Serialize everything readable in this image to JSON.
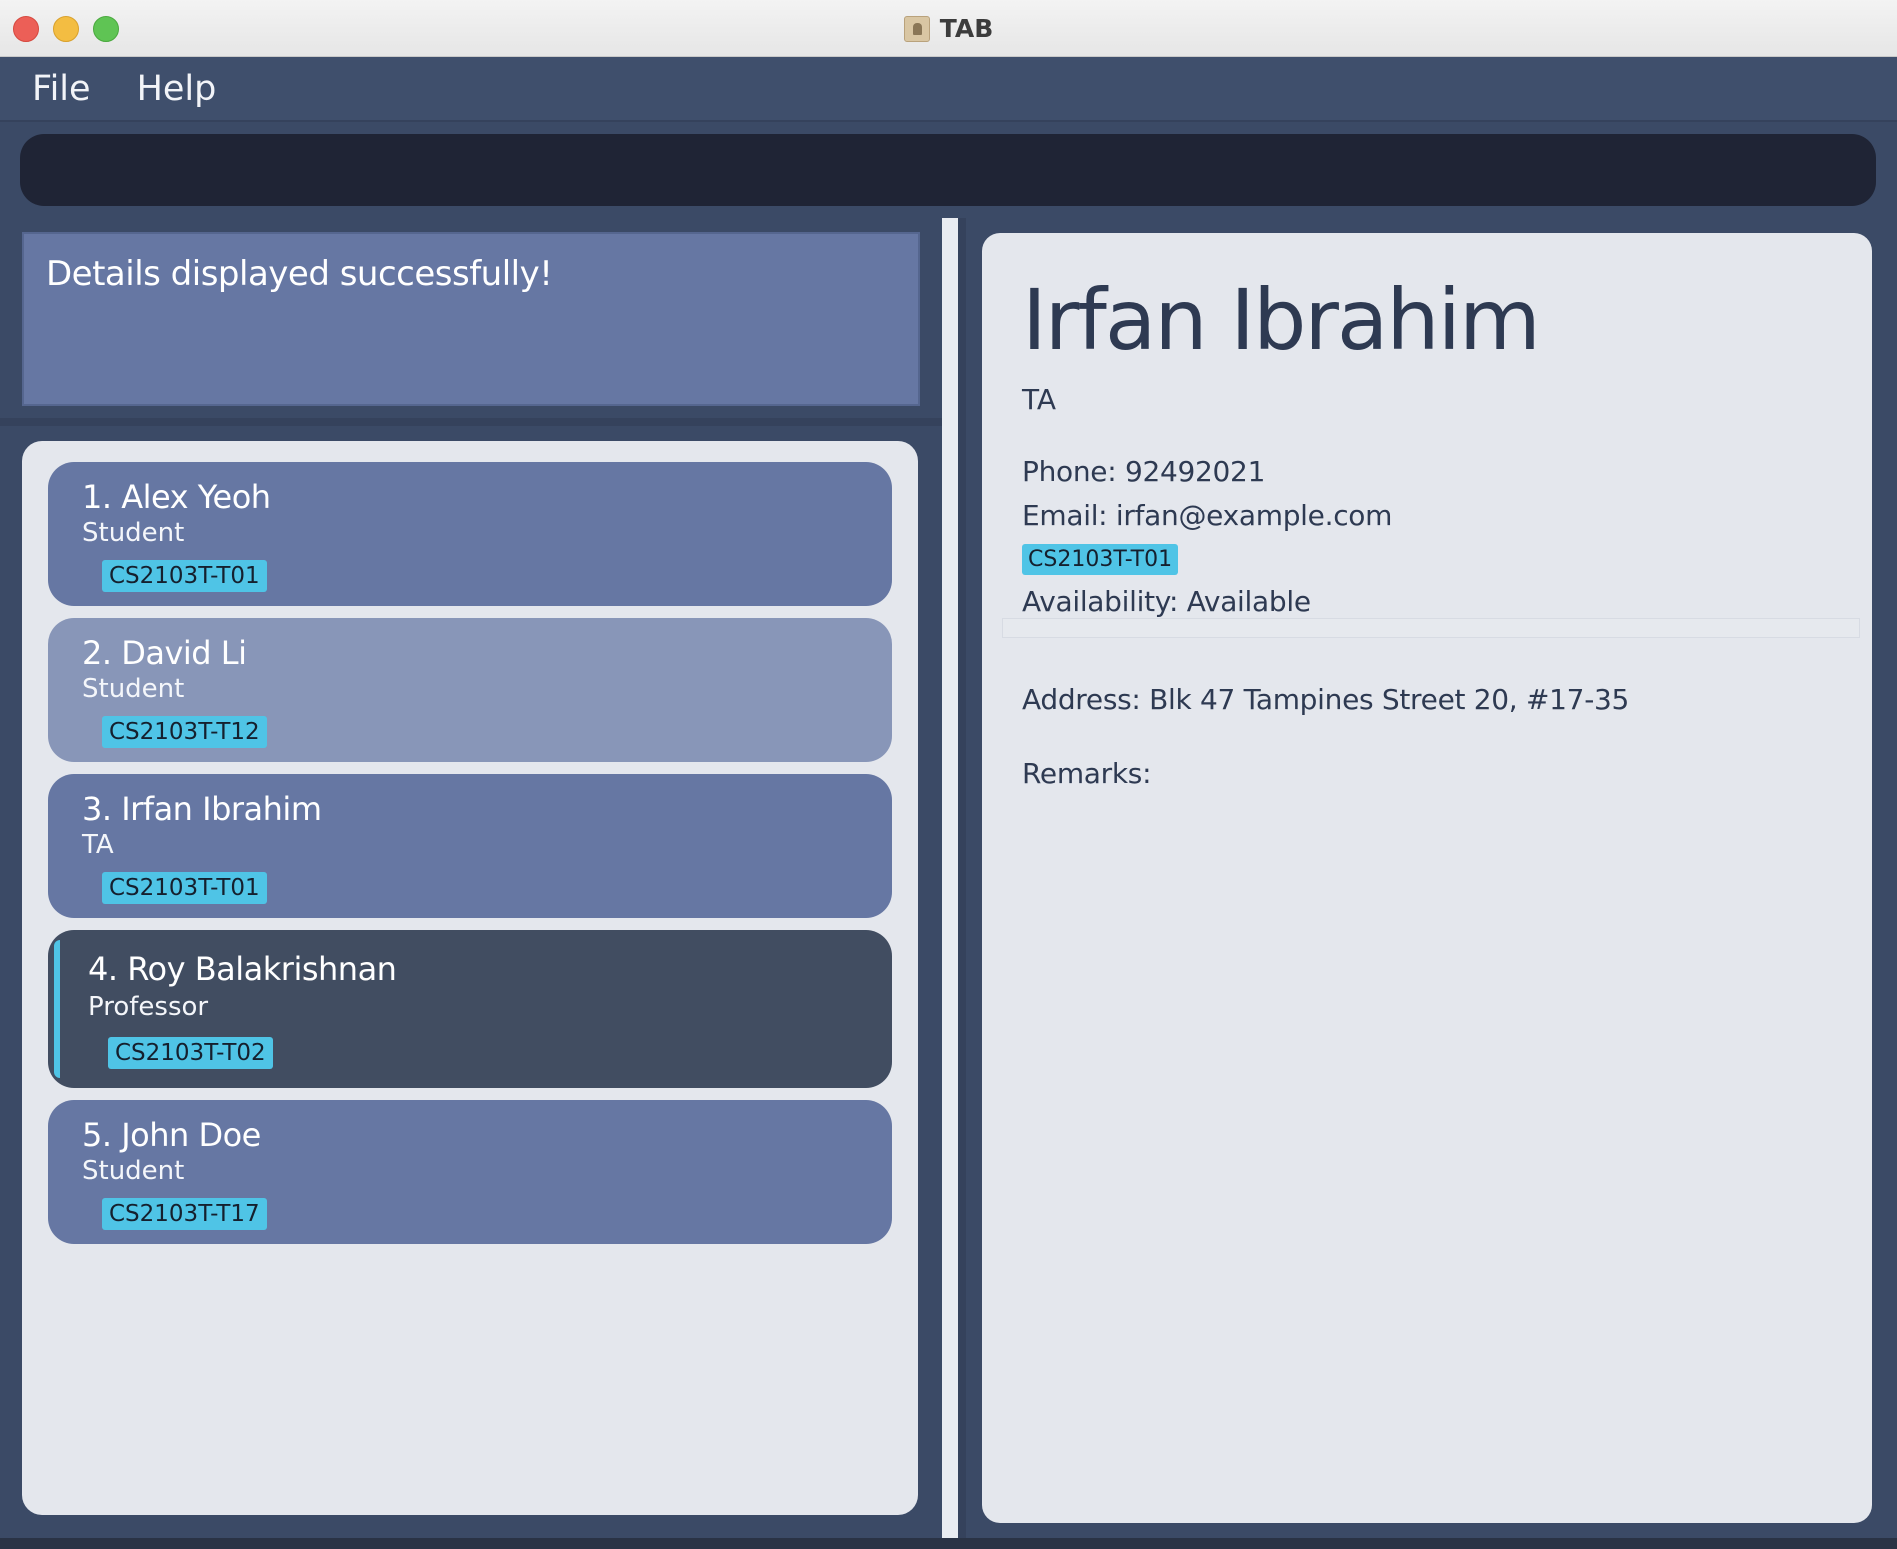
{
  "window": {
    "title": "TAB",
    "icon": "address-book-icon"
  },
  "menu": {
    "items": [
      "File",
      "Help"
    ]
  },
  "command": {
    "value": "",
    "placeholder": ""
  },
  "result": {
    "message": "Details displayed successfully!"
  },
  "persons": [
    {
      "index": "1.",
      "name": "Alex Yeoh",
      "role": "Student",
      "tag": "CS2103T-T01"
    },
    {
      "index": "2.",
      "name": "David Li",
      "role": "Student",
      "tag": "CS2103T-T12"
    },
    {
      "index": "3.",
      "name": "Irfan Ibrahim",
      "role": "TA",
      "tag": "CS2103T-T01"
    },
    {
      "index": "4.",
      "name": "Roy Balakrishnan",
      "role": "Professor",
      "tag": "CS2103T-T02"
    },
    {
      "index": "5.",
      "name": "John Doe",
      "role": "Student",
      "tag": "CS2103T-T17"
    }
  ],
  "person_labels": [
    "1.  Alex Yeoh",
    "2.  David Li",
    "3.  Irfan Ibrahim",
    "4.  Roy Balakrishnan",
    "5.  John Doe"
  ],
  "detail": {
    "name": "Irfan Ibrahim",
    "role": "TA",
    "phone": "Phone: 92492021",
    "email": "Email: irfan@example.com",
    "tag": "CS2103T-T01",
    "availability": "Availability: Available",
    "address": "Address: Blk 47 Tampines Street 20, #17-35",
    "remarks": "Remarks:"
  },
  "colors": {
    "background": "#3b4a66",
    "card": "#6677a3",
    "card_hover": "#8896b8",
    "card_selected": "#414d61",
    "tag": "#4fc4e6",
    "panel": "#e4e7ed"
  }
}
